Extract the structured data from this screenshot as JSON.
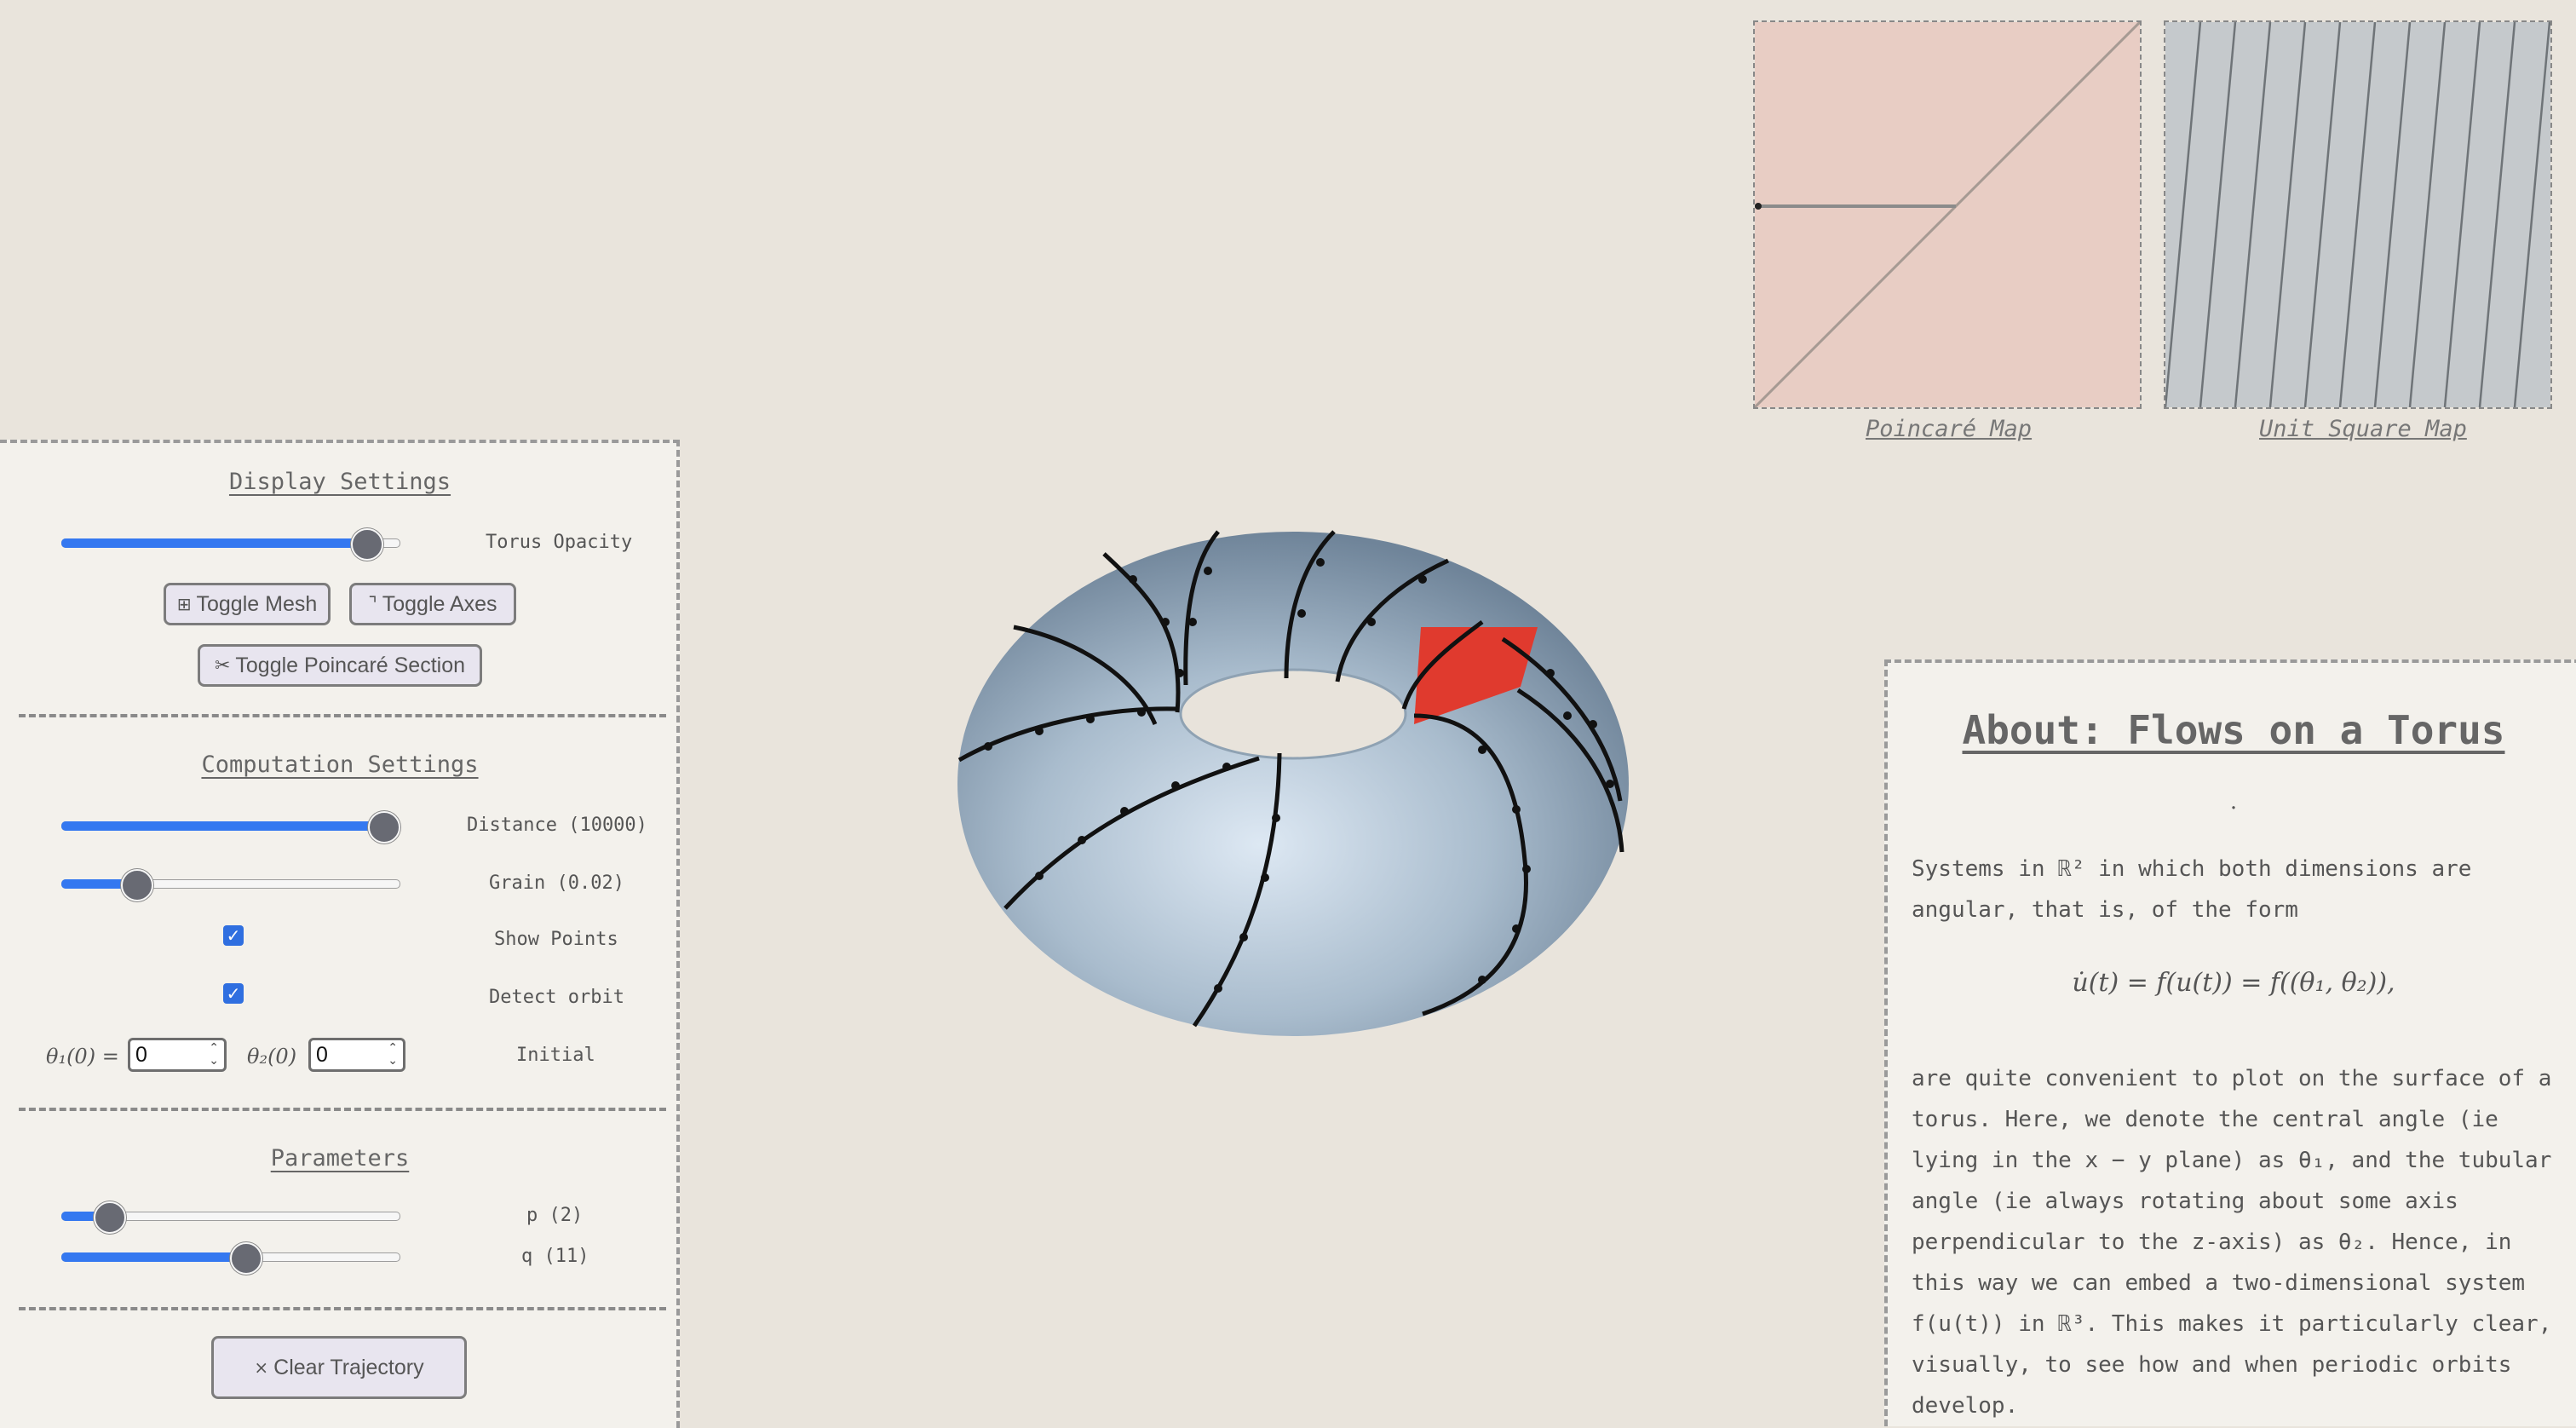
{
  "display": {
    "title": "Display Settings",
    "opacity_label": "Torus Opacity",
    "opacity_value": 0.93,
    "toggle_mesh_label": "Toggle Mesh",
    "toggle_axes_label": "Toggle Axes",
    "toggle_poincare_label": "Toggle Poincaré Section",
    "mesh_icon": "grid-icon",
    "axes_icon": "axes-icon",
    "poincare_icon": "scissors-icon"
  },
  "computation": {
    "title": "Computation Settings",
    "distance_label": "Distance (10000)",
    "distance_value": 1.0,
    "grain_label": "Grain (0.02)",
    "grain_value": 0.2,
    "show_points_label": "Show Points",
    "show_points_checked": true,
    "detect_orbit_label": "Detect orbit",
    "detect_orbit_checked": true,
    "theta1_label": "θ₁(0) =",
    "theta1_value": "0",
    "theta2_label": "θ₂(0)",
    "theta2_value": "0",
    "initial_label": "Initial"
  },
  "parameters": {
    "title": "Parameters",
    "p_label": "p (2)",
    "p_value": 0.12,
    "q_label": "q (11)",
    "q_value": 0.55
  },
  "clear_label": "Clear Trajectory",
  "clear_icon": "close-icon",
  "maps": {
    "poincare_caption": "Poincaré Map",
    "unit_square_caption": "Unit Square Map"
  },
  "about": {
    "title": "About: Flows on a Torus",
    "dot": ".",
    "p1a": "Systems in ℝ² in which both dimensions are angular, that is, of the form",
    "equation": "u̇(t) = f(u(t)) = f((θ₁, θ₂)),",
    "p2": "are quite convenient to plot on the surface of a torus. Here, we denote the central angle (ie lying in the x − y plane) as θ₁, and the tubular angle (ie always rotating about some axis perpendicular to the z-axis) as θ₂. Hence, in this way we can embed a two-dimensional system f(u(t)) in ℝ³. This makes it particularly clear, visually, to see how and when periodic orbits develop."
  },
  "colors": {
    "accent": "#3478f0",
    "poincare_bg": "#e8cdc4",
    "unit_bg": "#c5c9cc",
    "torus": "#a9bccd",
    "section": "#e03a2e"
  }
}
